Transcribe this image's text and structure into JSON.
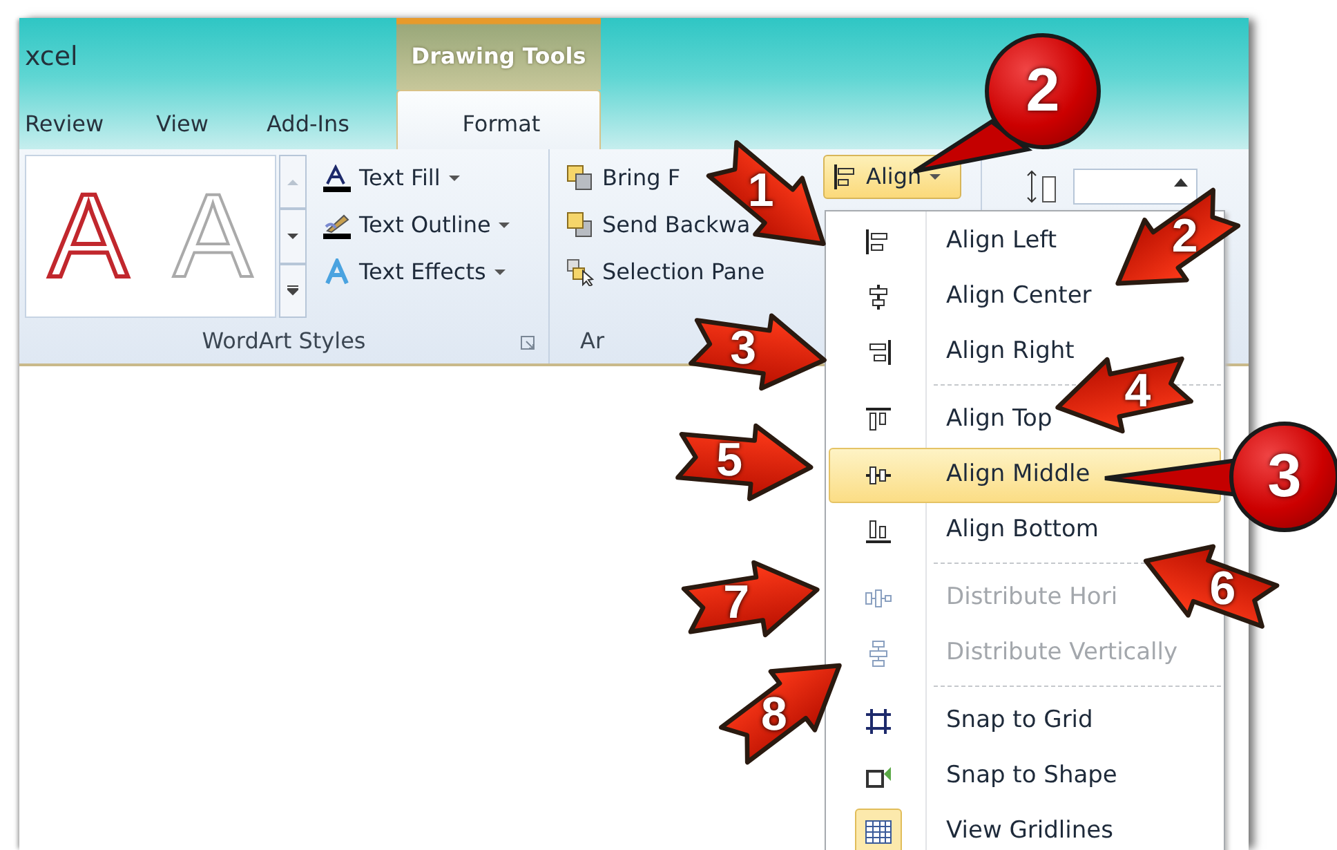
{
  "window": {
    "title": "xcel"
  },
  "contextual_tab_group": {
    "label": "Drawing Tools"
  },
  "tabs": [
    {
      "label": "Review",
      "selected": false
    },
    {
      "label": "View",
      "selected": false
    },
    {
      "label": "Add-Ins",
      "selected": false
    },
    {
      "label": "Format",
      "selected": true
    }
  ],
  "wordart_styles": {
    "label": "WordArt Styles",
    "gallery": [
      {
        "letter": "A",
        "kind": "red-outline"
      },
      {
        "letter": "A",
        "kind": "plain"
      }
    ],
    "commands": [
      {
        "label": "Text Fill"
      },
      {
        "label": "Text Outline"
      },
      {
        "label": "Text Effects"
      }
    ]
  },
  "arrange": {
    "label": "Ar",
    "commands": [
      {
        "label": "Bring F"
      },
      {
        "label": "Send Backwa"
      },
      {
        "label": "Selection Pane"
      }
    ],
    "align_button": {
      "label": "Align",
      "selected": true
    }
  },
  "menu": {
    "items": [
      {
        "kind": "item",
        "label": "Align Left",
        "selected": false,
        "disabled": false,
        "checked": false
      },
      {
        "kind": "item",
        "label": "Align Center",
        "selected": false,
        "disabled": false,
        "checked": false
      },
      {
        "kind": "item",
        "label": "Align Right",
        "selected": false,
        "disabled": false,
        "checked": false
      },
      {
        "kind": "separator"
      },
      {
        "kind": "item",
        "label": "Align Top",
        "selected": false,
        "disabled": false,
        "checked": false
      },
      {
        "kind": "item",
        "label": "Align Middle",
        "selected": true,
        "disabled": false,
        "checked": false
      },
      {
        "kind": "item",
        "label": "Align Bottom",
        "selected": false,
        "disabled": false,
        "checked": false
      },
      {
        "kind": "separator"
      },
      {
        "kind": "item",
        "label": "Distribute Hori",
        "selected": false,
        "disabled": true,
        "checked": false
      },
      {
        "kind": "item",
        "label": "Distribute Vertically",
        "selected": false,
        "disabled": true,
        "checked": false
      },
      {
        "kind": "separator"
      },
      {
        "kind": "item",
        "label": "Snap to Grid",
        "selected": false,
        "disabled": false,
        "checked": false
      },
      {
        "kind": "item",
        "label": "Snap to Shape",
        "selected": false,
        "disabled": false,
        "checked": false
      },
      {
        "kind": "item",
        "label": "View Gridlines",
        "selected": false,
        "disabled": false,
        "checked": true
      }
    ]
  },
  "callouts": [
    {
      "kind": "arrow",
      "number": "1"
    },
    {
      "kind": "arrow",
      "number": "2"
    },
    {
      "kind": "arrow",
      "number": "3"
    },
    {
      "kind": "arrow",
      "number": "4"
    },
    {
      "kind": "arrow",
      "number": "5"
    },
    {
      "kind": "arrow",
      "number": "6"
    },
    {
      "kind": "arrow",
      "number": "7"
    },
    {
      "kind": "arrow",
      "number": "8"
    },
    {
      "kind": "badge",
      "number": "2"
    },
    {
      "kind": "badge",
      "number": "3"
    }
  ]
}
